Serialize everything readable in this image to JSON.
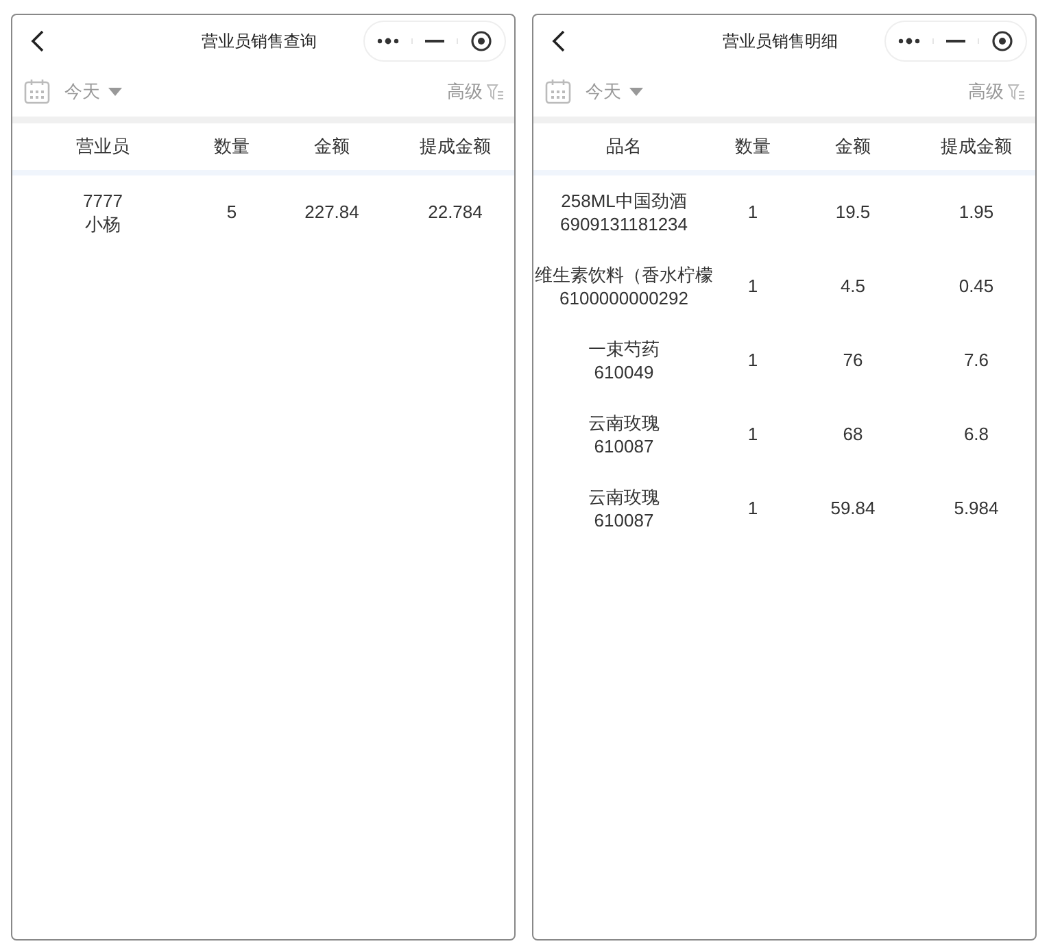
{
  "panels": [
    {
      "title": "营业员销售查询",
      "date_filter": "今天",
      "advanced": "高级",
      "columns": [
        "营业员",
        "数量",
        "金额",
        "提成金额"
      ],
      "rows": [
        {
          "label": [
            "7777",
            "小杨"
          ],
          "values": [
            "5",
            "227.84",
            "22.784"
          ]
        }
      ]
    },
    {
      "title": "营业员销售明细",
      "date_filter": "今天",
      "advanced": "高级",
      "columns": [
        "品名",
        "数量",
        "金额",
        "提成金额"
      ],
      "rows": [
        {
          "label": [
            "258ML中国劲酒",
            "6909131181234"
          ],
          "values": [
            "1",
            "19.5",
            "1.95"
          ]
        },
        {
          "label": [
            "维生素饮料（香水柠檬",
            "6100000000292"
          ],
          "values": [
            "1",
            "4.5",
            "0.45"
          ]
        },
        {
          "label": [
            "一束芍药",
            "610049"
          ],
          "values": [
            "1",
            "76",
            "7.6"
          ]
        },
        {
          "label": [
            "云南玫瑰",
            "610087"
          ],
          "values": [
            "1",
            "68",
            "6.8"
          ]
        },
        {
          "label": [
            "云南玫瑰",
            "610087"
          ],
          "values": [
            "1",
            "59.84",
            "5.984"
          ]
        }
      ]
    }
  ]
}
